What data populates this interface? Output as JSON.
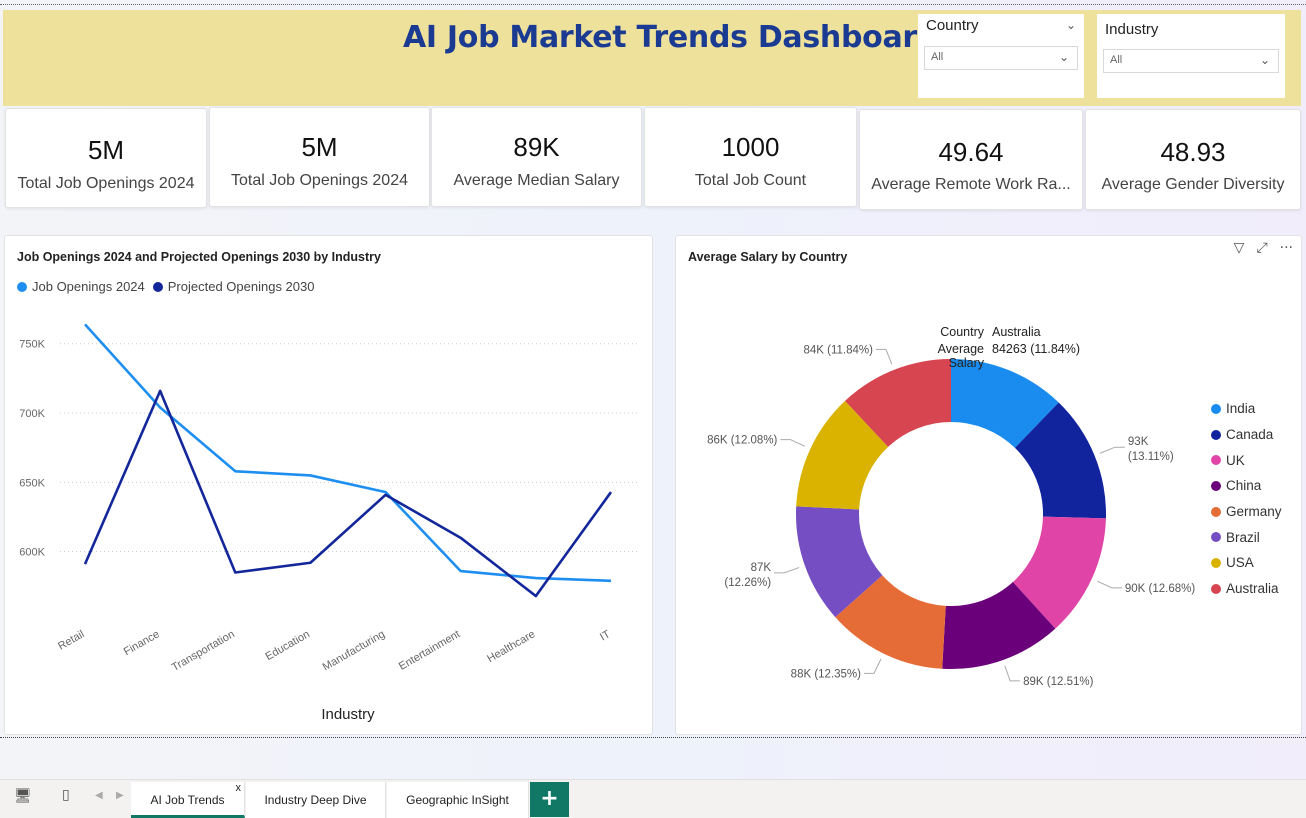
{
  "header": {
    "title": "AI Job Market Trends Dashboard",
    "bg_color": "#eee19c",
    "title_color": "#1b3b93"
  },
  "slicers": {
    "country": {
      "title": "Country",
      "value": "All"
    },
    "industry": {
      "title": "Industry",
      "value": "All"
    }
  },
  "kpis": [
    {
      "value": "5M",
      "label": "Total Job Openings 2024"
    },
    {
      "value": "5M",
      "label": "Total Job Openings 2024"
    },
    {
      "value": "89K",
      "label": "Average Median Salary"
    },
    {
      "value": "1000",
      "label": "Total Job Count"
    },
    {
      "value": "49.64",
      "label": "Average Remote Work Ra..."
    },
    {
      "value": "48.93",
      "label": "Average Gender Diversity"
    }
  ],
  "chart_data": [
    {
      "type": "line",
      "title": "Job Openings 2024 and Projected Openings 2030 by Industry",
      "xlabel": "Industry",
      "ylabel": "",
      "categories": [
        "Retail",
        "Finance",
        "Transportation",
        "Education",
        "Manufacturing",
        "Entertainment",
        "Healthcare",
        "IT"
      ],
      "series": [
        {
          "name": "Job Openings 2024",
          "color": "#1e8ff0",
          "values": [
            764000,
            704000,
            658000,
            655000,
            643000,
            586000,
            581000,
            579000
          ]
        },
        {
          "name": "Projected Openings 2030",
          "color": "#13279a",
          "values": [
            591000,
            716000,
            585000,
            592000,
            641000,
            610000,
            568000,
            643000
          ]
        }
      ],
      "yticks": [
        "600K",
        "650K",
        "700K",
        "750K"
      ],
      "ytick_values": [
        600000,
        650000,
        700000,
        750000
      ],
      "grid": true,
      "legend": "top-left"
    },
    {
      "type": "pie",
      "title": "Average Salary by Country",
      "legend": "right",
      "slices": [
        {
          "name": "India",
          "color": "#1a8cf0",
          "value": 86000,
          "label": ""
        },
        {
          "name": "Canada",
          "color": "#12239e",
          "value": 93000,
          "label": "93K (13.11%)"
        },
        {
          "name": "UK",
          "color": "#e044a7",
          "value": 90000,
          "label": "90K (12.68%)"
        },
        {
          "name": "China",
          "color": "#6b007b",
          "value": 89000,
          "label": "89K (12.51%)"
        },
        {
          "name": "Germany",
          "color": "#e66c37",
          "value": 88000,
          "label": "88K (12.35%)"
        },
        {
          "name": "Brazil",
          "color": "#744ec2",
          "value": 87000,
          "label": "87K (12.26%)"
        },
        {
          "name": "USA",
          "color": "#d9b300",
          "value": 86000,
          "label": "86K (12.08%)"
        },
        {
          "name": "Australia",
          "color": "#d64550",
          "value": 84263,
          "label": "84K (11.84%)"
        }
      ],
      "tooltip": {
        "k1": "Country",
        "v1": "Australia",
        "k2": "Average Salary",
        "v2": "84263 (11.84%)"
      }
    }
  ],
  "tabs": [
    {
      "label": "AI Job Trends",
      "close": "x"
    },
    {
      "label": "Industry Deep Dive"
    },
    {
      "label": "Geographic InSight"
    }
  ],
  "add_tab": "+",
  "icons": {
    "filter": "filter-icon",
    "focus": "focus-mode-icon",
    "more": "more-options-icon",
    "desktop": "desktop-icon",
    "mobile": "mobile-icon"
  }
}
